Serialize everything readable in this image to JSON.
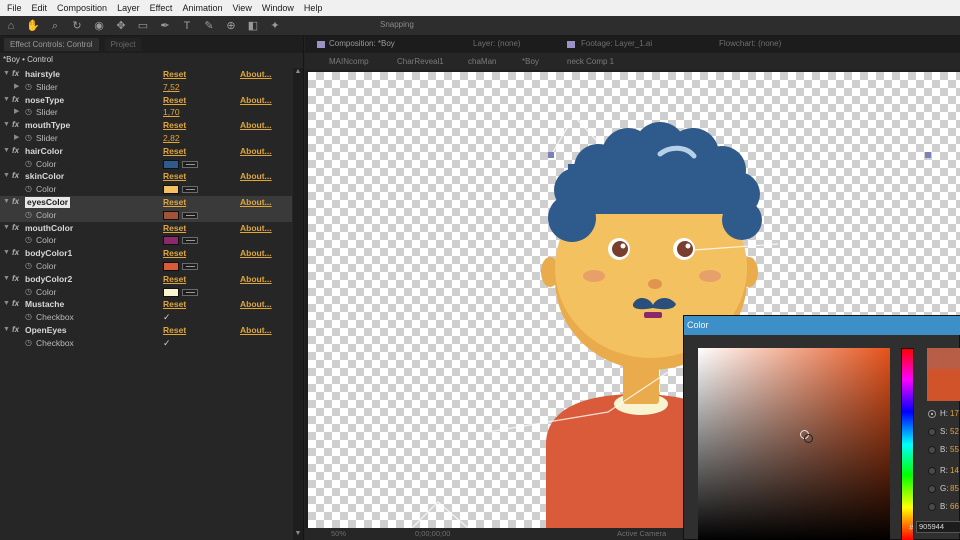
{
  "menubar": {
    "items": [
      "File",
      "Edit",
      "Composition",
      "Layer",
      "Effect",
      "Animation",
      "View",
      "Window",
      "Help"
    ]
  },
  "toolbar": {
    "snapping_label": "Snapping",
    "tools": [
      "home-icon",
      "hand-icon",
      "zoom-icon",
      "rotate-icon",
      "camera-icon",
      "pan-behind-icon",
      "mask-icon",
      "pen-icon",
      "text-icon",
      "brush-icon",
      "clone-icon",
      "eraser-icon",
      "puppet-icon"
    ]
  },
  "effect_controls": {
    "tab_label": "Effect Controls: Control",
    "tab2_label": "Project",
    "subtitle": "*Boy • Control",
    "reset_label": "Reset",
    "about_label": "About...",
    "effects": [
      {
        "name": "hairstyle",
        "param": "Slider",
        "kind": "slider",
        "value": "7,52"
      },
      {
        "name": "noseType",
        "param": "Slider",
        "kind": "slider",
        "value": "1,70"
      },
      {
        "name": "mouthType",
        "param": "Slider",
        "kind": "slider",
        "value": "2,82"
      },
      {
        "name": "hairColor",
        "param": "Color",
        "kind": "color",
        "value": "#2f5a8c"
      },
      {
        "name": "skinColor",
        "param": "Color",
        "kind": "color",
        "value": "#f3c15f"
      },
      {
        "name": "eyesColor",
        "param": "Color",
        "kind": "color",
        "value": "#a3523a",
        "selected": true
      },
      {
        "name": "mouthColor",
        "param": "Color",
        "kind": "color",
        "value": "#8a2a6a"
      },
      {
        "name": "bodyColor1",
        "param": "Color",
        "kind": "color",
        "value": "#d95b3a"
      },
      {
        "name": "bodyColor2",
        "param": "Color",
        "kind": "color",
        "value": "#f8f4d0"
      },
      {
        "name": "Mustache",
        "param": "Checkbox",
        "kind": "checkbox",
        "value": "✓"
      },
      {
        "name": "OpenEyes",
        "param": "Checkbox",
        "kind": "checkbox",
        "value": "✓"
      }
    ]
  },
  "composition": {
    "tabs": [
      "Composition: *Boy",
      "Layer: (none)",
      "Footage: Layer_1.ai",
      "Flowchart: (none)"
    ],
    "breadcrumbs": [
      "MAINcomp",
      "CharReveal1",
      "chaMan",
      "*Boy",
      "neck Comp 1"
    ],
    "zoom": "50%",
    "timecode": "0;00;00;00",
    "camera": "Active Camera"
  },
  "character": {
    "hair_color": "#2f5a8c",
    "skin_color": "#f3c15f",
    "eye_color": "#7a3e2c",
    "cheek_color": "#e8a06a",
    "mustache_color": "#2a4f7a",
    "shirt_color": "#d95b3a",
    "collar_color": "#f8f4d0",
    "neck_color": "#e9ab4c"
  },
  "color_picker": {
    "title": "Color",
    "hue_base": "#e6521a",
    "new_color": "#b85e47",
    "current_color": "#d0532a",
    "fields": [
      {
        "label": "H:",
        "value": "17"
      },
      {
        "label": "S:",
        "value": "52"
      },
      {
        "label": "B:",
        "value": "55"
      },
      {
        "label": "R:",
        "value": "14"
      },
      {
        "label": "G:",
        "value": "85"
      },
      {
        "label": "B:",
        "value": "66"
      }
    ],
    "hex": "905944"
  }
}
